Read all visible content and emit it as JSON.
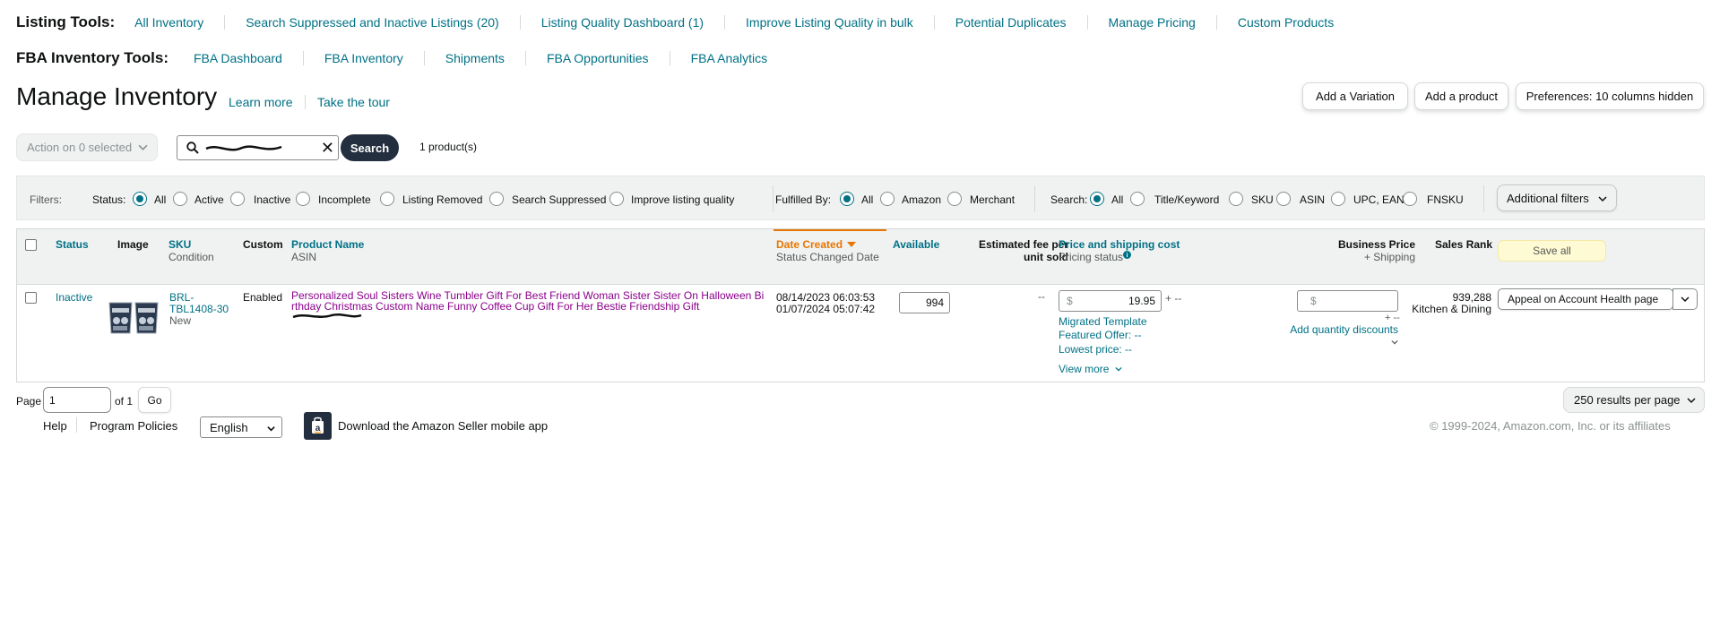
{
  "listing_tools": {
    "title": "Listing Tools:",
    "links": [
      "All Inventory",
      "Search Suppressed and Inactive Listings (20)",
      "Listing Quality Dashboard (1)",
      "Improve Listing Quality in bulk",
      "Potential Duplicates",
      "Manage Pricing",
      "Custom Products"
    ]
  },
  "fba_tools": {
    "title": "FBA Inventory Tools:",
    "links": [
      "FBA Dashboard",
      "FBA Inventory",
      "Shipments",
      "FBA Opportunities",
      "FBA Analytics"
    ]
  },
  "header": {
    "title": "Manage Inventory",
    "learn_more": "Learn more",
    "take_tour": "Take the tour",
    "buttons": {
      "add_variation": "Add a Variation",
      "add_product": "Add a product",
      "preferences": "Preferences: 10 columns hidden"
    }
  },
  "toolbar": {
    "action": "Action on 0 selected",
    "search_button": "Search",
    "product_count": "1 product(s)"
  },
  "filters": {
    "label": "Filters:",
    "status_label": "Status:",
    "status_options": [
      "All",
      "Active",
      "Inactive",
      "Incomplete",
      "Listing Removed",
      "Search Suppressed",
      "Improve listing quality"
    ],
    "status_selected": "All",
    "fulfilled_label": "Fulfilled By:",
    "fulfilled_options": [
      "All",
      "Amazon",
      "Merchant"
    ],
    "fulfilled_selected": "All",
    "search_label": "Search:",
    "search_options": [
      "All",
      "Title/Keyword",
      "SKU",
      "ASIN",
      "UPC, EAN",
      "FNSKU"
    ],
    "search_selected": "All",
    "additional_filters": "Additional filters"
  },
  "table": {
    "headers": {
      "status": "Status",
      "image": "Image",
      "sku": "SKU",
      "sku_sub": "Condition",
      "custom": "Custom",
      "product_name": "Product Name",
      "product_name_sub": "ASIN",
      "date_created": "Date Created",
      "date_created_sub": "Status Changed Date",
      "available": "Available",
      "est_fee_1": "Estimated fee per",
      "est_fee_2": "unit sold",
      "price": "Price and shipping cost",
      "price_sub": "Pricing status",
      "business_price": "Business Price",
      "business_price_sub": "+ Shipping",
      "sales_rank": "Sales Rank",
      "save_all": "Save all"
    },
    "rows": [
      {
        "status": "Inactive",
        "sku_line1": "BRL-",
        "sku_line2": "TBL1408-30",
        "condition": "New",
        "custom": "Enabled",
        "product_name_line1": "Personalized Soul Sisters Wine Tumbler Gift For Best Friend Woman Sister Sister On Halloween Bi",
        "product_name_line2": "rthday Christmas Custom Name Funny Coffee Cup Gift For Her Bestie Friendship Gift",
        "date_created": "08/14/2023 06:03:53",
        "status_changed": "01/07/2024 05:07:42",
        "available": "994",
        "est_fee": "--",
        "currency": "$",
        "price": "19.95",
        "shipping": "+ --",
        "pricing_status": "Migrated Template",
        "featured_offer": "Featured Offer: --",
        "lowest_price": "Lowest price: --",
        "view_more": "View more",
        "business_currency": "$",
        "business_shipping": "+ --",
        "quantity_discounts": "Add quantity discounts",
        "sales_rank": "939,288",
        "sales_rank_category": "Kitchen & Dining",
        "action": "Appeal on Account Health page"
      }
    ]
  },
  "pagination": {
    "page_label": "Page",
    "page_value": "1",
    "of_label": "of 1",
    "go": "Go",
    "results_per_page": "250 results per page"
  },
  "footer": {
    "help": "Help",
    "program_policies": "Program Policies",
    "language": "English",
    "app_text": "Download the Amazon Seller mobile app",
    "copyright": "© 1999-2024, Amazon.com, Inc. or its affiliates"
  },
  "colors": {
    "link": "#007185",
    "product_link": "#8a008a",
    "sort_active": "#e77600",
    "search_button": "#232f3e",
    "save_all_bg": "#fefad3"
  }
}
